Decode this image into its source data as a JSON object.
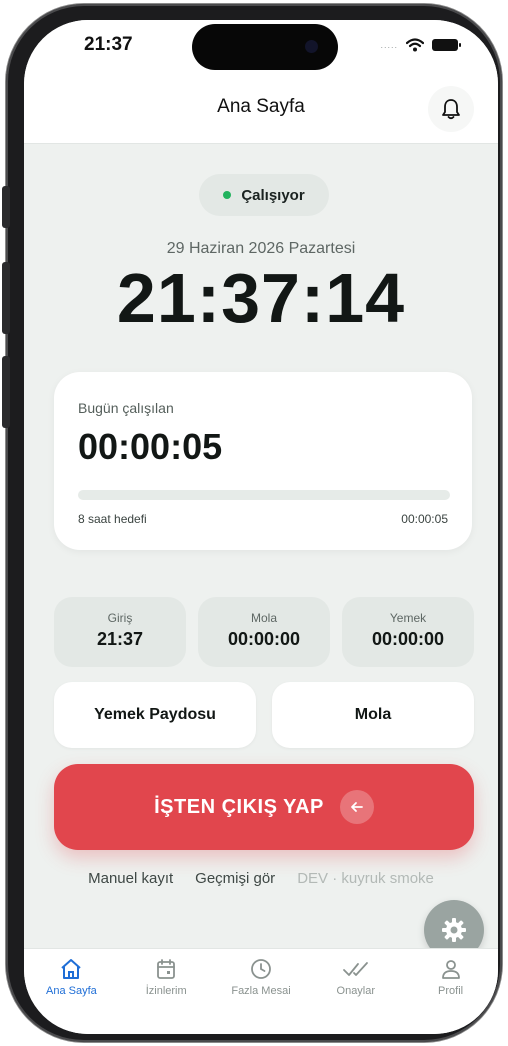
{
  "status_bar": {
    "time": "21:37",
    "signal": "....."
  },
  "header": {
    "title": "Ana Sayfa",
    "bell_icon": "bell-icon"
  },
  "status_pill": {
    "label": "Çalışıyor",
    "color": "#22b35e"
  },
  "clock": {
    "date": "29 Haziran 2026 Pazartesi",
    "time": "21:37:14"
  },
  "work_card": {
    "label": "Bugün çalışılan",
    "value": "00:00:05",
    "goal_label": "8 saat hedefi",
    "goal_value": "00:00:05",
    "progress": 0
  },
  "stats": [
    {
      "label": "Giriş",
      "value": "21:37"
    },
    {
      "label": "Mola",
      "value": "00:00:00"
    },
    {
      "label": "Yemek",
      "value": "00:00:00"
    }
  ],
  "actions": {
    "meal_break": "Yemek Paydosu",
    "break": "Mola"
  },
  "exit_button": {
    "label": "İŞTEN ÇIKIŞ YAP",
    "color": "#e1464d",
    "icon": "arrow-left-icon"
  },
  "links": {
    "manual": "Manuel kayıt",
    "history": "Geçmişi gör",
    "dev": "DEV · kuyruk smoke"
  },
  "fab": {
    "icon": "gear-icon"
  },
  "tabs": [
    {
      "label": "Ana Sayfa",
      "icon": "home-icon",
      "active": true
    },
    {
      "label": "İzinlerim",
      "icon": "calendar-icon",
      "active": false
    },
    {
      "label": "Fazla Mesai",
      "icon": "clock-icon",
      "active": false
    },
    {
      "label": "Onaylar",
      "icon": "double-check-icon",
      "active": false
    },
    {
      "label": "Profil",
      "icon": "user-icon",
      "active": false
    }
  ],
  "colors": {
    "accent": "#1f6ed6",
    "background": "#eef1ef",
    "danger": "#e1464d"
  }
}
